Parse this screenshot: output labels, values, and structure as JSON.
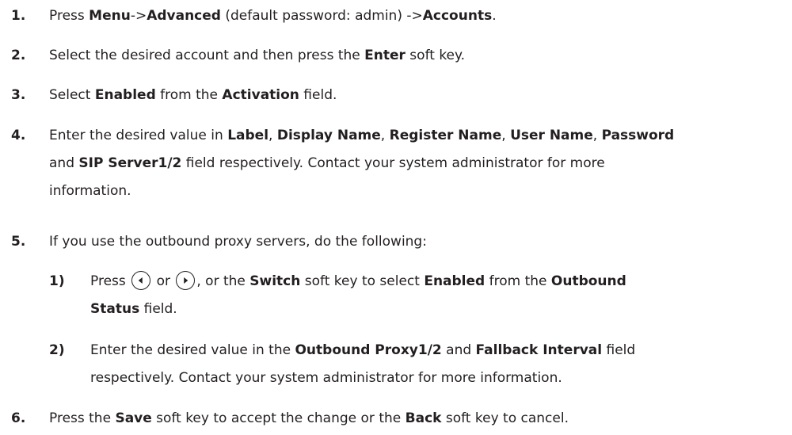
{
  "steps": [
    {
      "number": "1.",
      "parts": [
        "Press ",
        "Menu",
        "->",
        "Advanced",
        " (default password: admin) ->",
        "Accounts",
        "."
      ]
    },
    {
      "number": "2.",
      "parts": [
        "Select the desired account and then press the ",
        "Enter",
        " soft key."
      ]
    },
    {
      "number": "3.",
      "parts": [
        "Select ",
        "Enabled",
        " from the ",
        "Activation",
        " field."
      ]
    },
    {
      "number": "4.",
      "line1": [
        "Enter the desired value in ",
        "Label",
        ", ",
        "Display Name",
        ", ",
        "Register Name",
        ", ",
        "User Name",
        ", ",
        "Password"
      ],
      "line2": [
        "and ",
        "SIP Server1/2",
        " field respectively. Contact your system administrator for more"
      ],
      "line3": "information."
    },
    {
      "number": "5.",
      "parts": [
        "If you use the outbound proxy servers, do the following:"
      ]
    },
    {
      "number": "6.",
      "parts": [
        "Press the ",
        "Save",
        " soft key to accept the change or the ",
        "Back",
        " soft key to cancel."
      ]
    }
  ],
  "substeps": [
    {
      "number": "1)",
      "line1": [
        "Press ",
        "or",
        ", or the ",
        "Switch",
        " soft key to select ",
        "Enabled",
        " from the ",
        "Outbound"
      ],
      "line2": [
        "Status",
        " field."
      ],
      "icons": [
        "left-arrow-key-icon",
        "right-arrow-key-icon"
      ]
    },
    {
      "number": "2)",
      "line1": [
        "Enter the desired value in the ",
        "Outbound Proxy1/2",
        " and ",
        "Fallback Interval",
        " field"
      ],
      "line2": "respectively. Contact your system administrator for more information."
    }
  ]
}
